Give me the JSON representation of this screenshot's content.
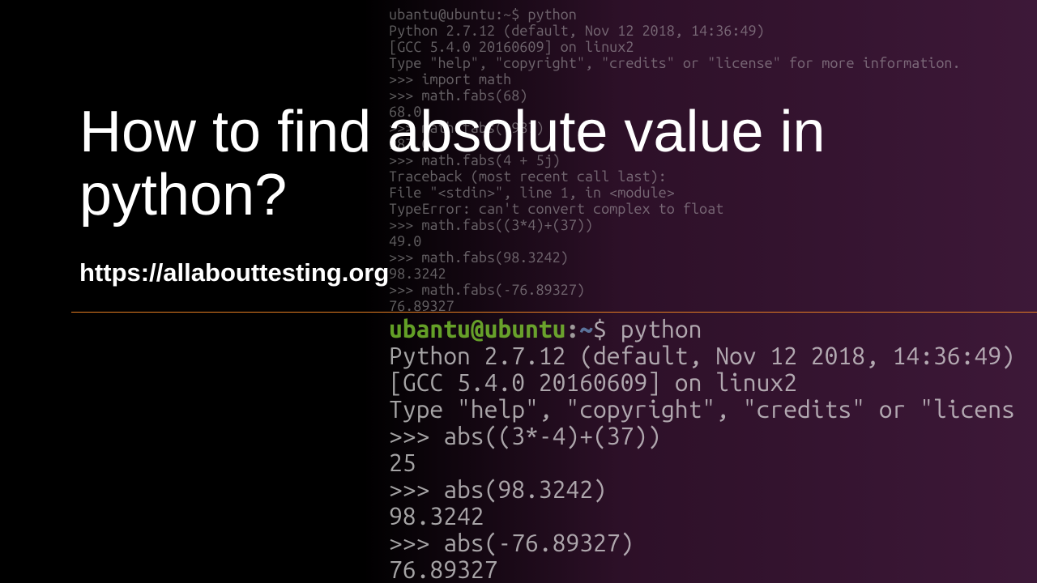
{
  "title": "How to find absolute value in python?",
  "url": "https://allabouttesting.org",
  "terminal_top": {
    "lines": [
      "ubantu@ubuntu:~$ python",
      "Python 2.7.12 (default, Nov 12 2018, 14:36:49)",
      "[GCC 5.4.0 20160609] on linux2",
      "Type \"help\", \"copyright\", \"credits\" or \"license\" for more information.",
      ">>> import math",
      ">>> math.fabs(68)",
      "68.0",
      ">>> math.fabs(-987)",
      "987.0",
      ">>> math.fabs(4 + 5j)",
      "Traceback (most recent call last):",
      "  File \"<stdin>\", line 1, in <module>",
      "TypeError: can't convert complex to float",
      ">>> math.fabs((3*4)+(37))",
      "49.0",
      ">>> math.fabs(98.3242)",
      "98.3242",
      ">>> math.fabs(-76.89327)",
      "76.89327"
    ]
  },
  "terminal_bottom": {
    "prompt_user": "ubantu@ubuntu",
    "prompt_sep": ":",
    "prompt_path": "~",
    "prompt_cmd": "$ python",
    "lines": [
      "Python 2.7.12 (default, Nov 12 2018, 14:36:49)",
      "[GCC 5.4.0 20160609] on linux2",
      "Type \"help\", \"copyright\", \"credits\" or \"licens",
      ">>> abs((3*-4)+(37))",
      "25",
      ">>> abs(98.3242)",
      "98.3242",
      ">>> abs(-76.89327)",
      "76.89327"
    ]
  }
}
